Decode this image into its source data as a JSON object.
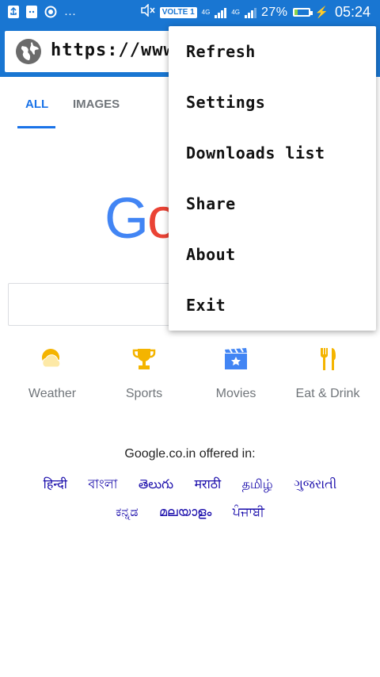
{
  "status_bar": {
    "volte": "VOLTE 1",
    "network_1": "4G",
    "network_2": "4G",
    "battery_percent": "27%",
    "battery_level": 0.27,
    "time": "05:24",
    "overflow": "···"
  },
  "address_bar": {
    "url": "https://www"
  },
  "tabs": [
    {
      "label": "ALL",
      "active": true
    },
    {
      "label": "IMAGES",
      "active": false
    }
  ],
  "logo": {
    "text": "Go"
  },
  "shortcuts": [
    {
      "label": "Weather",
      "icon": "weather-icon"
    },
    {
      "label": "Sports",
      "icon": "trophy-icon"
    },
    {
      "label": "Movies",
      "icon": "movies-icon"
    },
    {
      "label": "Eat & Drink",
      "icon": "fork-knife-icon"
    }
  ],
  "offered_in": {
    "label": "Google.co.in offered in:",
    "languages": [
      "हिन्दी",
      "বাংলা",
      "తెలుగు",
      "मराठी",
      "தமிழ்",
      "ગુજરાતી",
      "ಕನ್ನಡ",
      "മലയാളം",
      "ਪੰਜਾਬੀ"
    ]
  },
  "menu": {
    "items": [
      "Refresh",
      "Settings",
      "Downloads list",
      "Share",
      "About",
      "Exit"
    ]
  },
  "colors": {
    "primary": "#1976d2",
    "link": "#1a0dab",
    "tab_active": "#1a73e8",
    "google_blue": "#4285f4",
    "google_red": "#ea4335"
  }
}
